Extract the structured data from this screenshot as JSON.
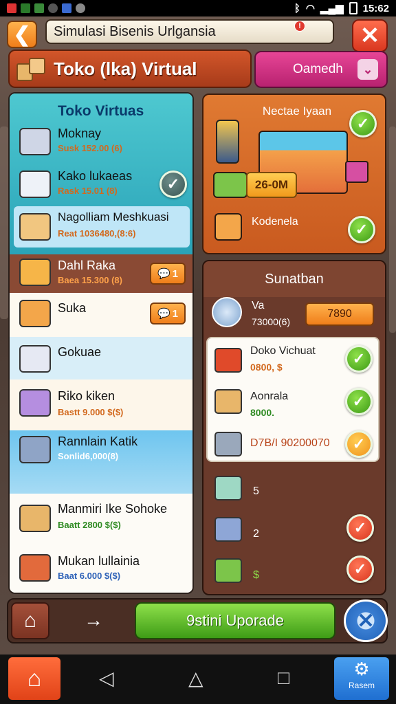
{
  "status_bar": {
    "time": "15:62"
  },
  "header": {
    "back_symbol": "❮",
    "title": "Simulasi Bisenis Urlgansia",
    "title_badge": "!",
    "close_symbol": "✕",
    "shop_title": "Toko (lka) Virtual",
    "dropdown_label": "Oamedh"
  },
  "left_panel": {
    "title": "Toko Virtuas",
    "items": [
      {
        "name": "Moknay",
        "price": "Susk 152.00 (6)"
      },
      {
        "name": "Kako lukaeas",
        "price": "Rask 15.01 (8)"
      },
      {
        "name": "Nagolliam Meshkuasi",
        "price": "Reat 1036480,(8:6)"
      },
      {
        "name": "Dahl Raka",
        "price": "Baea 15.300 (8)"
      },
      {
        "name": "Suka",
        "price": ""
      },
      {
        "name": "Gokuae",
        "price": ""
      },
      {
        "name": "Riko kiken",
        "price": "Bastt 9.000 $($)"
      },
      {
        "name": "Rannlain Katik",
        "price": "Sonlid6,000(8)"
      },
      {
        "name": "Manmiri Ike Sohoke",
        "price": "Baatt 2800 $($)"
      },
      {
        "name": "Mukan lullainia",
        "price": "Baat 6.000 $($)"
      }
    ],
    "badge_a": "1",
    "badge_b": "1"
  },
  "right_top": {
    "title": "Nectae Iyaan",
    "price_tag": "26-0M",
    "item_label": "Kodenela"
  },
  "right_bottom": {
    "title": "Sunatban",
    "stat_label": "Va",
    "stat_value": "73000(6)",
    "stat_button": "7890",
    "card_items": [
      {
        "name": "Doko Vichuat",
        "sub": "0800, $"
      },
      {
        "name": "Aonrala",
        "sub": "8000."
      },
      {
        "name": "D7B/I 90200070",
        "sub": ""
      }
    ],
    "list_items": [
      {
        "count": "5"
      },
      {
        "count": "2"
      },
      {
        "count": "$"
      }
    ]
  },
  "action_bar": {
    "home_symbol": "⌂",
    "arrow_symbol": "→",
    "upgrade_label": "9stini Uporade",
    "cancel_symbol": "✕"
  },
  "navbar": {
    "home_symbol": "⌂",
    "back_symbol": "◁",
    "center_symbol": "△",
    "square_symbol": "□",
    "right_label": "Rasem"
  }
}
